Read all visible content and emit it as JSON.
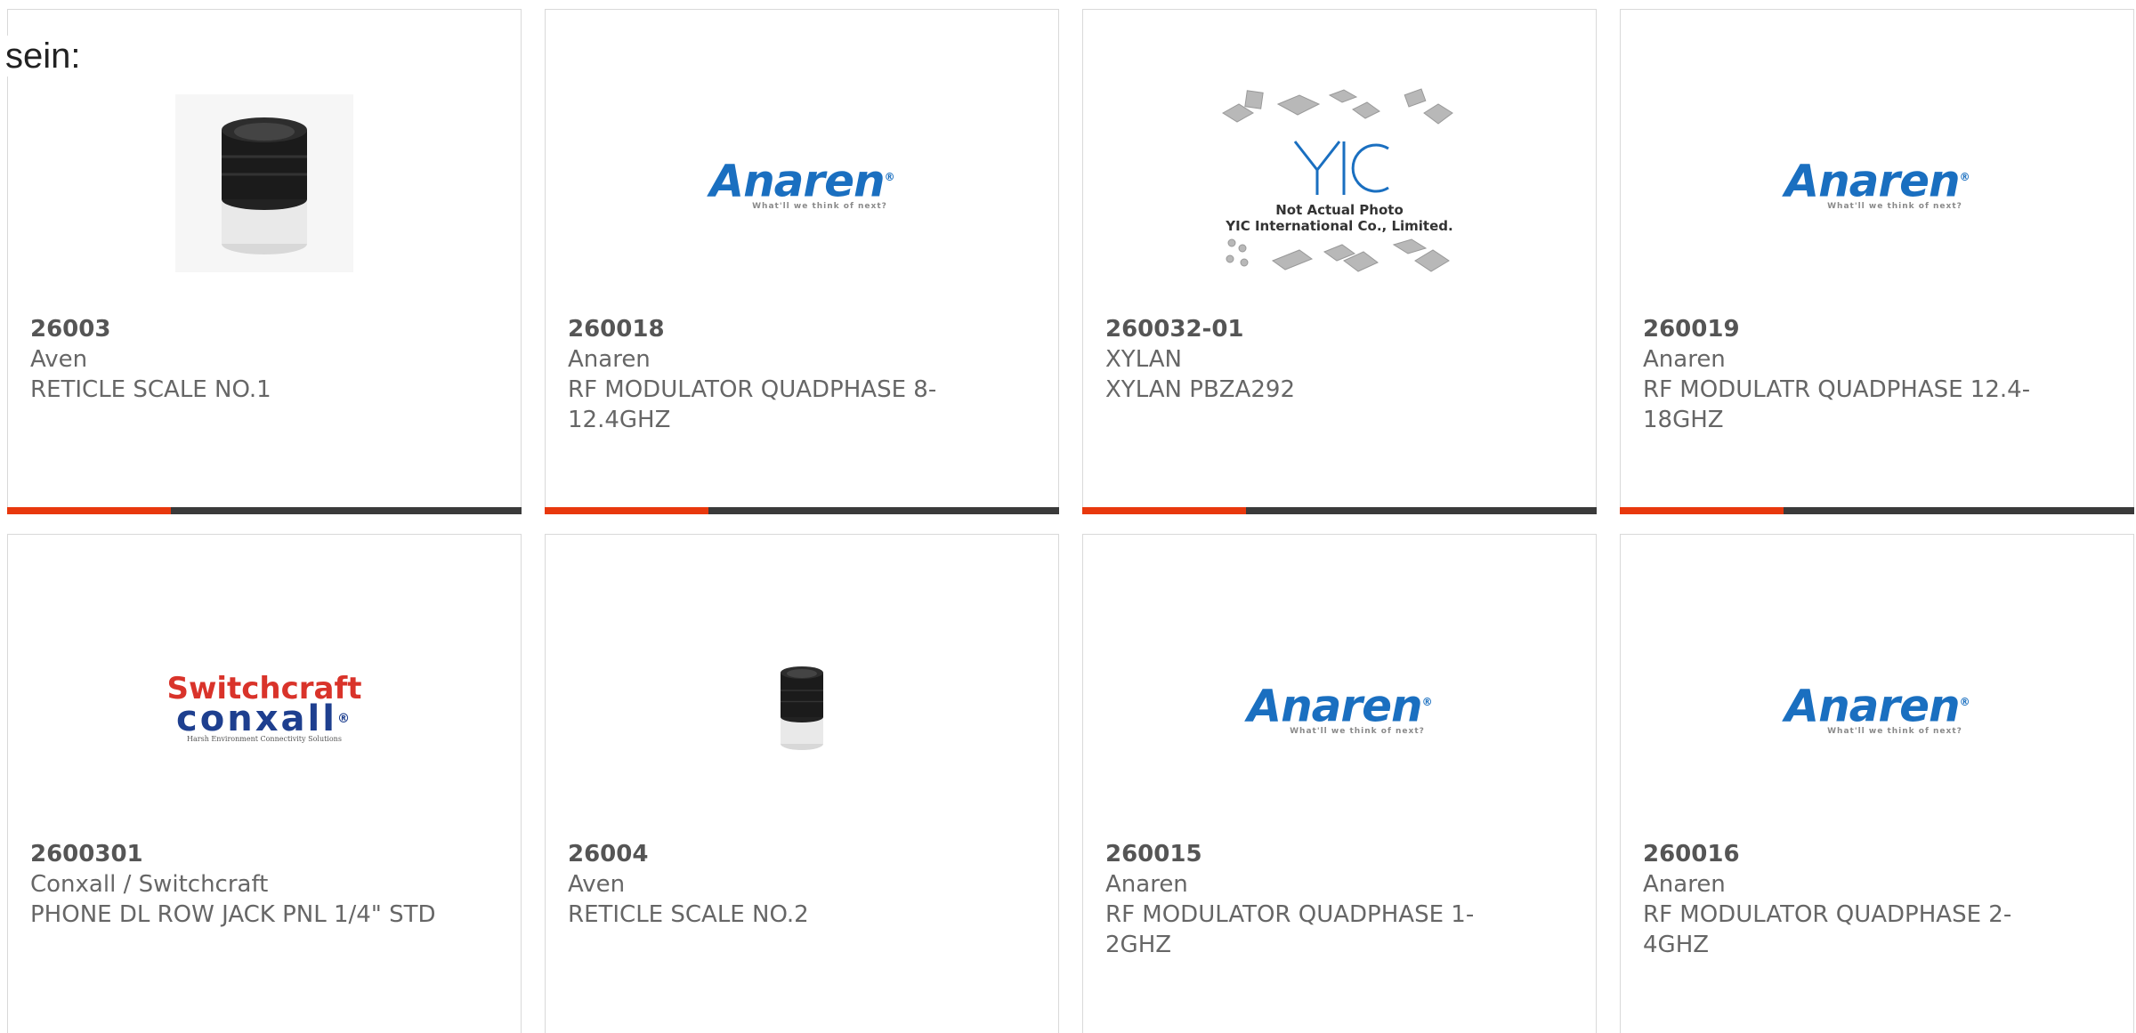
{
  "page": {
    "prefix": "sein:"
  },
  "products": [
    {
      "part": "26003",
      "brand": "Aven",
      "desc": "RETICLE SCALE NO.1",
      "image": "loupe-photo"
    },
    {
      "part": "260018",
      "brand": "Anaren",
      "desc": "RF MODULATOR QUADPHASE 8-12.4GHZ",
      "image": "anaren-logo"
    },
    {
      "part": "260032-01",
      "brand": "XYLAN",
      "desc": "XYLAN PBZA292",
      "image": "yic-placeholder"
    },
    {
      "part": "260019",
      "brand": "Anaren",
      "desc": "RF MODULATR QUADPHASE 12.4-18GHZ",
      "image": "anaren-logo"
    },
    {
      "part": "2600301",
      "brand": "Conxall / Switchcraft",
      "desc": "PHONE DL ROW JACK PNL 1/4\" STD",
      "image": "switchcraft-logo"
    },
    {
      "part": "26004",
      "brand": "Aven",
      "desc": "RETICLE SCALE NO.2",
      "image": "loupe-photo"
    },
    {
      "part": "260015",
      "brand": "Anaren",
      "desc": "RF MODULATOR QUADPHASE 1-2GHZ",
      "image": "anaren-logo"
    },
    {
      "part": "260016",
      "brand": "Anaren",
      "desc": "RF MODULATOR QUADPHASE 2-4GHZ",
      "image": "anaren-logo"
    }
  ],
  "logos": {
    "anaren_word": "Anaren",
    "anaren_tag": "What'll we think of next?",
    "switchcraft": "Switchcraft",
    "conxall": "conxall",
    "conxall_tag": "Harsh Environment Connectivity Solutions",
    "yic_line1": "Not Actual Photo",
    "yic_line2": "YIC International Co., Limited."
  },
  "colors": {
    "accent": "#e8380d",
    "bar": "#3a3a3a",
    "anaren_blue": "#1a6fc0"
  }
}
